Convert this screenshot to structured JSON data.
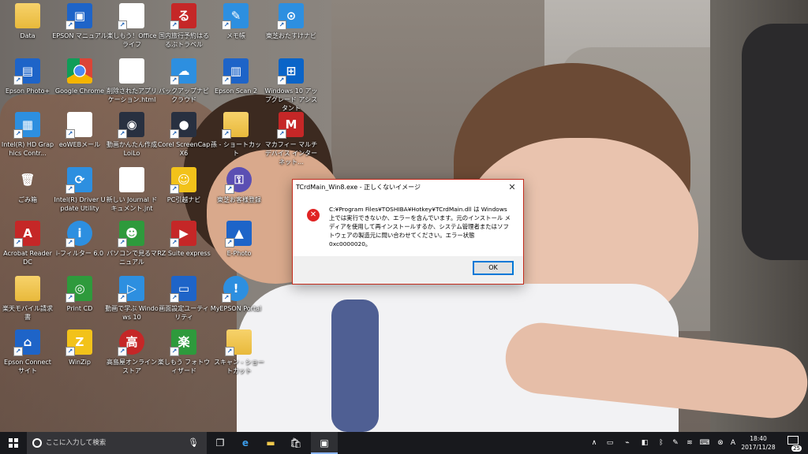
{
  "desktop": {
    "icons": [
      {
        "label": "Data",
        "icon": "folder-icon"
      },
      {
        "label": "EPSON マニュアル",
        "icon": "epson-manual-icon"
      },
      {
        "label": "楽しもう！Office ライフ",
        "icon": "office-life-icon"
      },
      {
        "label": "国内旅行予約はるるぶトラベル",
        "icon": "rurubu-travel-icon"
      },
      {
        "label": "メモ帳",
        "icon": "notepad-icon"
      },
      {
        "label": "東芝おたすけナビ",
        "icon": "toshiba-help-icon"
      },
      {
        "label": "Epson Photo+",
        "icon": "epson-photo-icon"
      },
      {
        "label": "Google Chrome",
        "icon": "chrome-icon"
      },
      {
        "label": "削除されたアプリケーション.html",
        "icon": "html-file-icon"
      },
      {
        "label": "バックアップナビ クラウド",
        "icon": "backup-navi-icon"
      },
      {
        "label": "Epson Scan 2",
        "icon": "epson-scan-icon"
      },
      {
        "label": "Windows 10 アップグレード アシスタント",
        "icon": "windows-logo-icon"
      },
      {
        "label": "Intel(R) HD Graphics Contr...",
        "icon": "intel-graphics-icon"
      },
      {
        "label": "eoWEBメール",
        "icon": "eoweb-mail-icon"
      },
      {
        "label": "動画かんたん作成 LoiLo",
        "icon": "loilo-icon"
      },
      {
        "label": "Corel ScreenCap X6",
        "icon": "screencap-icon"
      },
      {
        "label": "孫 - ショートカット",
        "icon": "folder-shortcut-icon"
      },
      {
        "label": "マカフィー マルチデバイス インターネット...",
        "icon": "mcafee-icon"
      },
      {
        "label": "ごみ箱",
        "icon": "recycle-bin-icon"
      },
      {
        "label": "Intel(R) Driver Update Utility",
        "icon": "intel-driver-icon"
      },
      {
        "label": "新しい Journal ドキュメント.jnt",
        "icon": "journal-doc-icon"
      },
      {
        "label": "PC引越ナビ",
        "icon": "pc-move-navi-icon"
      },
      {
        "label": "東芝お客様登録",
        "icon": "toshiba-register-icon"
      },
      {
        "label": "Acrobat Reader DC",
        "icon": "acrobat-icon"
      },
      {
        "label": "i-フィルター 6.0",
        "icon": "i-filter-icon"
      },
      {
        "label": "パソコンで見るマニュアル",
        "icon": "pc-manual-icon"
      },
      {
        "label": "RZ Suite express",
        "icon": "rz-suite-icon"
      },
      {
        "label": "E-Photo",
        "icon": "e-photo-icon"
      },
      {
        "label": "楽天モバイル請求書",
        "icon": "rakuten-folder-icon"
      },
      {
        "label": "Print CD",
        "icon": "print-cd-icon"
      },
      {
        "label": "動画で学ぶ Windows 10",
        "icon": "windows-video-icon"
      },
      {
        "label": "画面設定ユーティリティ",
        "icon": "screen-settings-icon"
      },
      {
        "label": "MyEPSON Portal",
        "icon": "myepson-icon"
      },
      {
        "label": "Epson Connect サイト",
        "icon": "epson-connect-icon"
      },
      {
        "label": "WinZip",
        "icon": "winzip-icon"
      },
      {
        "label": "高島屋オンラインストア",
        "icon": "takashimaya-icon"
      },
      {
        "label": "楽しもう フォトウィザード",
        "icon": "photo-wizard-icon"
      },
      {
        "label": "スキャン - ショートカット",
        "icon": "scan-shortcut-icon"
      }
    ]
  },
  "dialog": {
    "title": "TCrdMain_Win8.exe - 正しくないイメージ",
    "message": "C:¥Program Files¥TOSHIBA¥Hotkey¥TCrdMain.dll は Windows 上では実行できないか、エラーを含んでいます。元のインストール メディアを使用して再インストールするか、システム管理者またはソフトウェアの製造元に問い合わせてください。エラー状態 0xc0000020。",
    "ok_label": "OK",
    "close_glyph": "✕",
    "error_glyph": "✕"
  },
  "taskbar": {
    "search_placeholder": "ここに入力して検索",
    "clock_time": "18:40",
    "clock_date": "2017/11/28",
    "notification_count": "25"
  },
  "colors": {
    "dialog_border": "#c42b1c",
    "accent": "#0078d7",
    "taskbar": "#121418"
  }
}
